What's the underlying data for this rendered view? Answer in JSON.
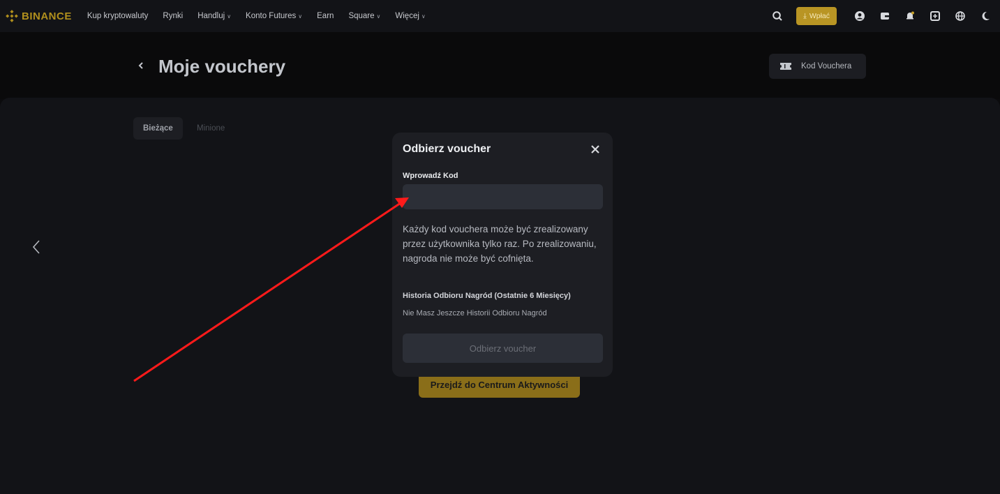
{
  "nav": {
    "brand": "BINANCE",
    "items": [
      {
        "label": "Kup kryptowaluty",
        "dropdown": false
      },
      {
        "label": "Rynki",
        "dropdown": false
      },
      {
        "label": "Handluj",
        "dropdown": true
      },
      {
        "label": "Konto Futures",
        "dropdown": true
      },
      {
        "label": "Earn",
        "dropdown": false
      },
      {
        "label": "Square",
        "dropdown": true
      },
      {
        "label": "Więcej",
        "dropdown": true
      }
    ],
    "deposit_label": "Wpłać",
    "icons": [
      "search-icon",
      "download-icon",
      "user-icon",
      "wallet-icon",
      "bell-icon",
      "qr-download-icon",
      "globe-icon",
      "moon-icon"
    ]
  },
  "header": {
    "title": "Moje vouchery",
    "voucher_code_label": "Kod Vouchera"
  },
  "tabs": {
    "current": "Bieżące",
    "past": "Minione"
  },
  "main": {
    "activity_button": "Przejdź do Centrum Aktywności"
  },
  "modal": {
    "title": "Odbierz voucher",
    "field_label": "Wprowadź Kod",
    "input_value": "",
    "info_text": "Każdy kod vouchera może być zrealizowany przez użytkownika tylko raz. Po zrealizowaniu, nagroda nie może być cofnięta.",
    "history_title": "Historia Odbioru Nagród (Ostatnie 6 Miesięcy)",
    "history_empty": "Nie Masz Jeszcze Historii Odbioru Nagród",
    "submit_label": "Odbierz voucher"
  },
  "colors": {
    "brand": "#b08f1d",
    "accent": "#b99524",
    "annotation": "#ff1a1a"
  }
}
